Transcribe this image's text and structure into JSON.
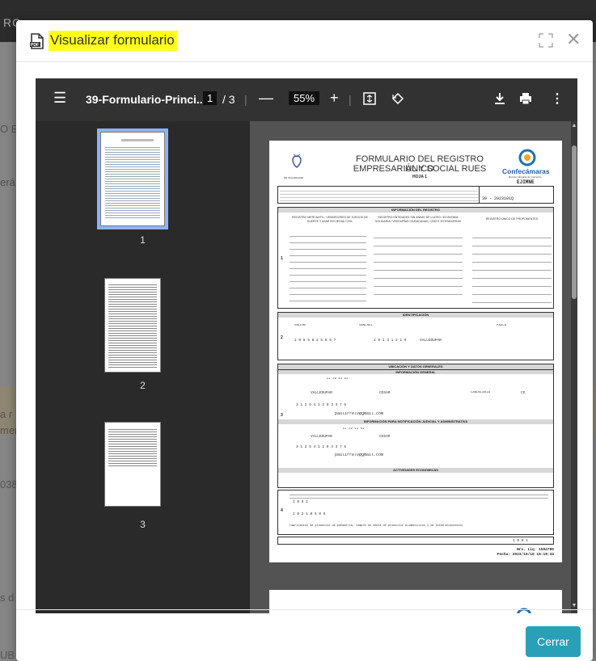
{
  "background": {
    "top_text": "RC",
    "fragments": [
      "O E",
      "erá",
      "a r",
      "mer",
      "038",
      "s d",
      "UB"
    ]
  },
  "modal": {
    "title": "Visualizar formulario",
    "close_label": "Cerrar"
  },
  "viewer": {
    "filename": "39-Formulario-Princi...",
    "page_current": "1",
    "page_total": "/ 3",
    "zoom": "55%",
    "thumbnails": [
      "1",
      "2",
      "3"
    ]
  },
  "document": {
    "title_line1": "FORMULARIO DEL REGISTRO ÚNICO",
    "title_line2": "EMPRESARIAL Y SOCIAL RUES",
    "sheet": "HOJA 1",
    "logo_text": "Confecámaras",
    "logo_sub": "Red de Cámaras de Comercio",
    "chamber": "DE VALLEDUPAR",
    "code": "EJIMNE",
    "form_id": "39 - 2023101Q",
    "sections": [
      "INFORMACIÓN DEL REGISTRO",
      "IDENTIFICACIÓN",
      "UBICACIÓN Y DATOS GENERALES",
      "INFORMACIÓN GENERAL",
      "INFORMACIÓN PARA NOTIFICACIÓN JUDICIAL Y ADMINISTRATIVA",
      "ACTIVIDADES ECONÓMICAS"
    ],
    "col1": "REGISTRO MERCANTIL / VENDEDORES DE JUEGOS DE SUERTE Y AZAR SOCIEDAD CIVIL",
    "col2": "REGISTRO ENTIDADES SIN ÁNIMO DE LUCRO / ECONOMÍA SOLIDARIA / VEEDURÍAS CIUDADANAS / ONG E EXTRANJERAS",
    "col3": "REGISTRO ÚNICO DE PROPONENTES",
    "surname1": "VALERO",
    "surname2": "SANCHEZ",
    "given": "PAULA",
    "id_number": "1 0 6 5 8 2 5 9 5 7",
    "exp_date": "2 0 1 3 1 2 1 9",
    "exp_city": "VALLEDUPAR",
    "address": "CL 22 11 51",
    "city": "VALLEDUPAR",
    "dept": "CESAR",
    "locality": "CANDELARIA",
    "country": "CO",
    "phone": "3 1 2 5 4 1 2 9 3 3 7 6",
    "email": "paulirrelv@gmail.com",
    "ciiu": "1 0 8 1",
    "start_date": "2 0 2 1 0 5 0 6",
    "activity_desc": "Fabricación de productos de panadería, compra de venta de productos alimenticios y de establecimientos",
    "reg_no": "Nro. Liq. 1504780",
    "printed": "Fecha: 2023/10/10 16:18:34"
  }
}
